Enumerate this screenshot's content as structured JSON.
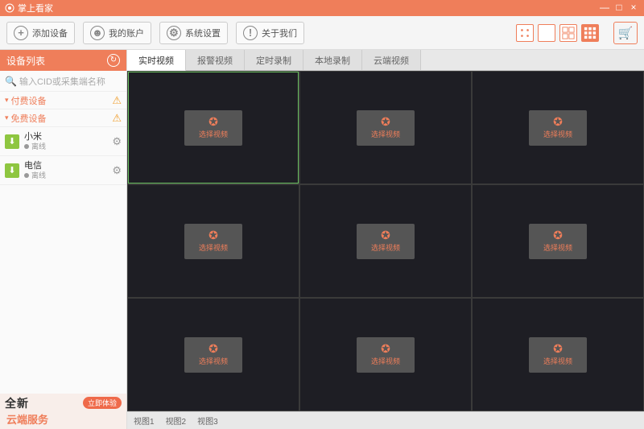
{
  "app": {
    "title": "掌上看家"
  },
  "window": {
    "minimize": "—",
    "maximize": "□",
    "close": "×"
  },
  "toolbar": {
    "add": "添加设备",
    "account": "我的账户",
    "settings": "系统设置",
    "about": "关于我们"
  },
  "sidebar": {
    "title": "设备列表",
    "search_placeholder": "输入CID或采集端名称",
    "cat_paid": "付费设备",
    "cat_free": "免费设备",
    "devices": [
      {
        "name": "小米",
        "status": "离线"
      },
      {
        "name": "电信",
        "status": "离线"
      }
    ]
  },
  "promo": {
    "line1": "全新",
    "line2": "云端服务",
    "btn": "立即体验"
  },
  "tabs": [
    "实时视频",
    "报警视频",
    "定时录制",
    "本地录制",
    "云端视频"
  ],
  "cell_label": "选择视频",
  "views": [
    "视图1",
    "视图2",
    "视图3"
  ]
}
